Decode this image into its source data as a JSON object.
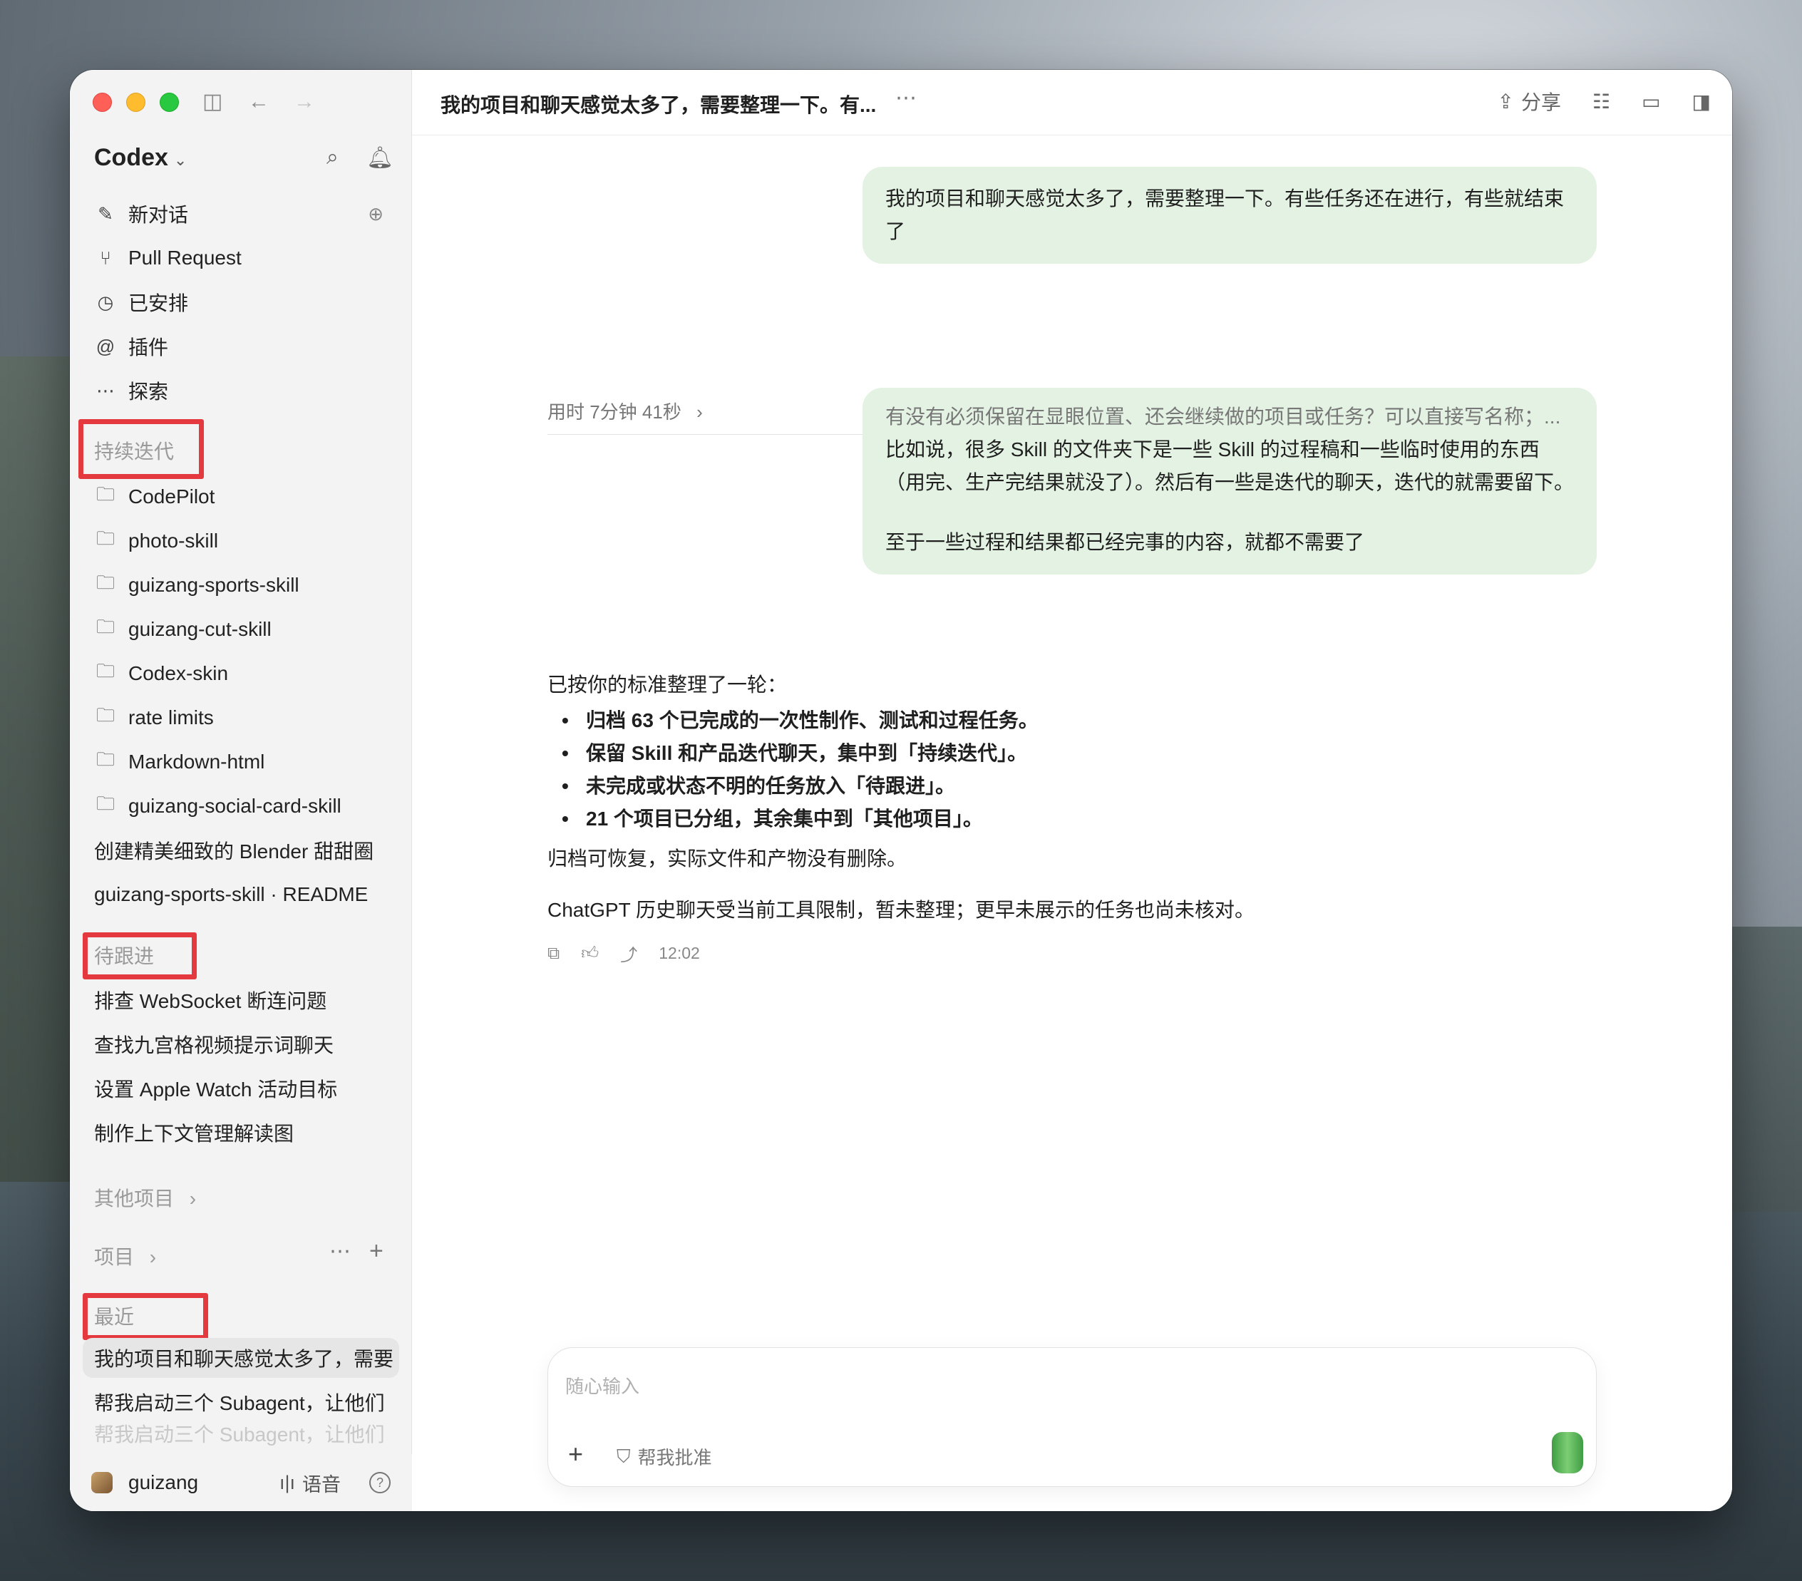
{
  "window": {
    "chat_title": "我的项目和聊天感觉太多了，需要整理一下。有...",
    "title_more": "⋯",
    "share_label": "分享"
  },
  "sidebar": {
    "brand": "Codex",
    "nav": [
      {
        "label": "新对话",
        "icon": "edit-icon"
      },
      {
        "label": "Pull Request",
        "icon": "pull-request-icon"
      },
      {
        "label": "已安排",
        "icon": "clock-icon"
      },
      {
        "label": "插件",
        "icon": "plugin-icon"
      },
      {
        "label": "探索",
        "icon": "more-icon"
      }
    ],
    "section_ongoing": "持续迭代",
    "projects": [
      "CodePilot",
      "photo-skill",
      "guizang-sports-skill",
      "guizang-cut-skill",
      "Codex-skin",
      "rate limits",
      "Markdown-html",
      "guizang-social-card-skill"
    ],
    "ongoing_chats": [
      "创建精美细致的 Blender 甜甜圈",
      "guizang-sports-skill · README"
    ],
    "section_followup": "待跟进",
    "followup_items": [
      "排查 WebSocket 断连问题",
      "查找九宫格视频提示词聊天",
      "设置 Apple Watch 活动目标",
      "制作上下文管理解读图"
    ],
    "other_projects": "其他项目",
    "projects_label": "项目",
    "section_recent": "最近",
    "recent_items": [
      "我的项目和聊天感觉太多了，需要",
      "帮我启动三个 Subagent，让他们",
      "帮我启动三个 Subagent，让他们"
    ],
    "user": "guizang",
    "voice_label": "语音"
  },
  "conversation": {
    "user_message_1": "我的项目和聊天感觉太多了，需要整理一下。有些任务还在进行，有些就结束了",
    "timing": "用时 7分钟 41秒",
    "user_message_2_quote": "有没有必须保留在显眼位置、还会继续做的项目或任务？可以直接写名称；...",
    "user_message_2_line1": "比如说，很多 Skill 的文件夹下是一些 Skill 的过程稿和一些临时使用的东西",
    "user_message_2_line2": "（用完、生产完结果就没了）。然后有一些是迭代的聊天，迭代的就需要留下。",
    "user_message_2_line3": "至于一些过程和结果都已经完事的内容，就都不需要了",
    "answer_intro": "已按你的标准整理了一轮：",
    "answer_bullets": [
      "归档 63 个已完成的一次性制作、测试和过程任务。",
      "保留 Skill 和产品迭代聊天，集中到「持续迭代」。",
      "未完成或状态不明的任务放入「待跟进」。",
      "21 个项目已分组，其余集中到「其他项目」。"
    ],
    "answer_p2": "归档可恢复，实际文件和产物没有删除。",
    "answer_p3": "ChatGPT 历史聊天受当前工具限制，暂未整理；更早未展示的任务也尚未核对。",
    "timestamp": "12:02"
  },
  "composer": {
    "placeholder": "随心输入",
    "approve_label": "帮我批准"
  },
  "colors": {
    "bubble": "#e3f2e2",
    "highlight_box": "#e53940",
    "send_button": "#4caf50"
  }
}
